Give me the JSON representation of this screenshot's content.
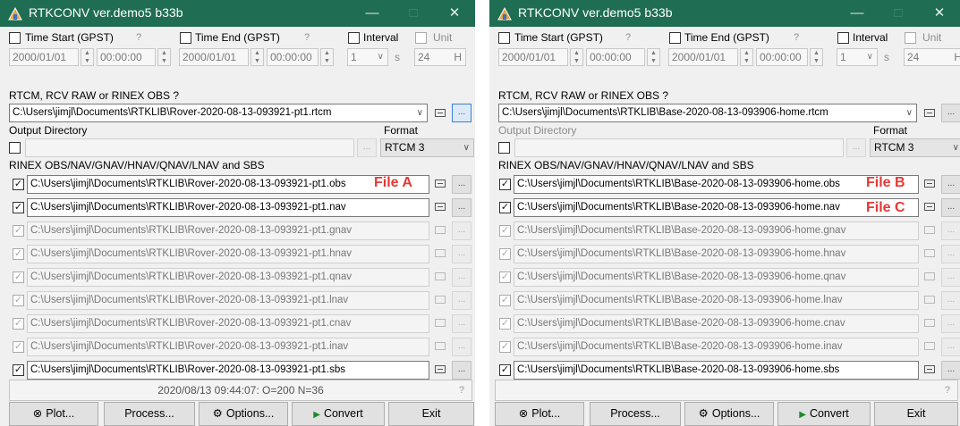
{
  "windows": [
    {
      "title": "RTKCONV ver.demo5 b33b",
      "time_start_label": "Time Start (GPST)",
      "time_end_label": "Time End (GPST)",
      "help_glyph": "?",
      "interval_label": "Interval",
      "unit_label": "Unit",
      "start_date": "2000/01/01",
      "start_time": "00:00:00",
      "end_date": "2000/01/01",
      "end_time": "00:00:00",
      "interval_value": "1",
      "interval_unit": "s",
      "unit_value": "24",
      "unit_suffix": "H",
      "input_label": "RTCM, RCV RAW or RINEX OBS  ?",
      "input_file": "C:\\Users\\jimjl\\Documents\\RTKLIB\\Rover-2020-08-13-093921-pt1.rtcm",
      "output_dir_label": "Output Directory",
      "format_label": "Format",
      "format_value": "RTCM 3",
      "rinex_label": "RINEX OBS/NAV/GNAV/HNAV/QNAV/LNAV and SBS",
      "files": [
        {
          "path": "C:\\Users\\jimjl\\Documents\\RTKLIB\\Rover-2020-08-13-093921-pt1.obs",
          "note": "File A"
        },
        {
          "path": "C:\\Users\\jimjl\\Documents\\RTKLIB\\Rover-2020-08-13-093921-pt1.nav",
          "note": ""
        },
        {
          "path": "C:\\Users\\jimjl\\Documents\\RTKLIB\\Rover-2020-08-13-093921-pt1.gnav",
          "note": ""
        },
        {
          "path": "C:\\Users\\jimjl\\Documents\\RTKLIB\\Rover-2020-08-13-093921-pt1.hnav",
          "note": ""
        },
        {
          "path": "C:\\Users\\jimjl\\Documents\\RTKLIB\\Rover-2020-08-13-093921-pt1.qnav",
          "note": ""
        },
        {
          "path": "C:\\Users\\jimjl\\Documents\\RTKLIB\\Rover-2020-08-13-093921-pt1.lnav",
          "note": ""
        },
        {
          "path": "C:\\Users\\jimjl\\Documents\\RTKLIB\\Rover-2020-08-13-093921-pt1.cnav",
          "note": ""
        },
        {
          "path": "C:\\Users\\jimjl\\Documents\\RTKLIB\\Rover-2020-08-13-093921-pt1.inav",
          "note": ""
        },
        {
          "path": "C:\\Users\\jimjl\\Documents\\RTKLIB\\Rover-2020-08-13-093921-pt1.sbs",
          "note": ""
        }
      ],
      "status_text": "2020/08/13 09:44:07: O=200 N=36",
      "buttons": {
        "plot": "Plot...",
        "process": "Process...",
        "options": "Options...",
        "convert": "Convert",
        "exit": "Exit"
      }
    },
    {
      "title": "RTKCONV ver.demo5 b33b",
      "time_start_label": "Time Start (GPST)",
      "time_end_label": "Time End (GPST)",
      "help_glyph": "?",
      "interval_label": "Interval",
      "unit_label": "Unit",
      "start_date": "2000/01/01",
      "start_time": "00:00:00",
      "end_date": "2000/01/01",
      "end_time": "00:00:00",
      "interval_value": "1",
      "interval_unit": "s",
      "unit_value": "24",
      "unit_suffix": "H",
      "input_label": "RTCM, RCV RAW or RINEX OBS  ?",
      "input_file": "C:\\Users\\jimjl\\Documents\\RTKLIB\\Base-2020-08-13-093906-home.rtcm",
      "output_dir_label": "Output Directory",
      "format_label": "Format",
      "format_value": "RTCM 3",
      "rinex_label": "RINEX OBS/NAV/GNAV/HNAV/QNAV/LNAV and SBS",
      "files": [
        {
          "path": "C:\\Users\\jimjl\\Documents\\RTKLIB\\Base-2020-08-13-093906-home.obs",
          "note": "File B"
        },
        {
          "path": "C:\\Users\\jimjl\\Documents\\RTKLIB\\Base-2020-08-13-093906-home.nav",
          "note": "File C"
        },
        {
          "path": "C:\\Users\\jimjl\\Documents\\RTKLIB\\Base-2020-08-13-093906-home.gnav",
          "note": ""
        },
        {
          "path": "C:\\Users\\jimjl\\Documents\\RTKLIB\\Base-2020-08-13-093906-home.hnav",
          "note": ""
        },
        {
          "path": "C:\\Users\\jimjl\\Documents\\RTKLIB\\Base-2020-08-13-093906-home.qnav",
          "note": ""
        },
        {
          "path": "C:\\Users\\jimjl\\Documents\\RTKLIB\\Base-2020-08-13-093906-home.lnav",
          "note": ""
        },
        {
          "path": "C:\\Users\\jimjl\\Documents\\RTKLIB\\Base-2020-08-13-093906-home.cnav",
          "note": ""
        },
        {
          "path": "C:\\Users\\jimjl\\Documents\\RTKLIB\\Base-2020-08-13-093906-home.inav",
          "note": ""
        },
        {
          "path": "C:\\Users\\jimjl\\Documents\\RTKLIB\\Base-2020-08-13-093906-home.sbs",
          "note": ""
        }
      ],
      "status_text": "",
      "buttons": {
        "plot": "Plot...",
        "process": "Process...",
        "options": "Options...",
        "convert": "Convert",
        "exit": "Exit"
      }
    }
  ]
}
